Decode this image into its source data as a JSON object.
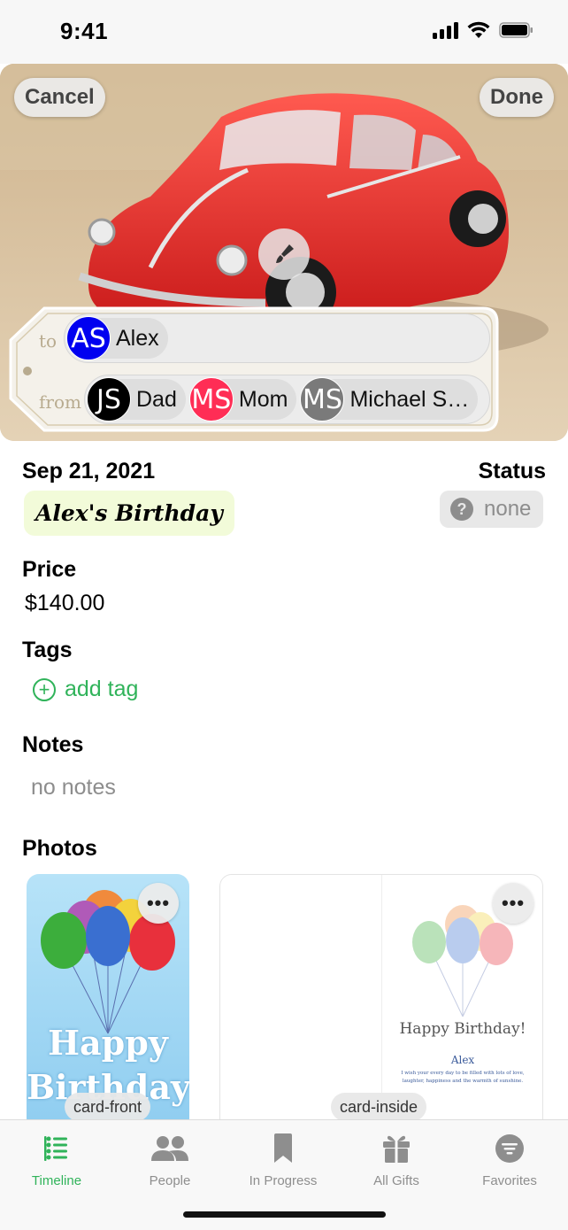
{
  "status_bar": {
    "time": "9:41"
  },
  "hero": {
    "cancel_label": "Cancel",
    "done_label": "Done",
    "tag": {
      "to_label": "to",
      "from_label": "from",
      "to": [
        {
          "initials": "AS",
          "name": "Alex",
          "color": "#0000f0"
        }
      ],
      "from": [
        {
          "initials": "JS",
          "name": "Dad",
          "color": "#000000"
        },
        {
          "initials": "MS",
          "name": "Mom",
          "color": "#ff2d55"
        },
        {
          "initials": "MS",
          "name": "Michael S…",
          "color": "#7a7a7a"
        }
      ]
    }
  },
  "details": {
    "date": "Sep 21, 2021",
    "occasion": "Alex's Birthday",
    "status_label": "Status",
    "status_value": "none",
    "price_label": "Price",
    "price_value": "$140.00",
    "tags_label": "Tags",
    "add_tag_label": "add tag",
    "notes_label": "Notes",
    "notes_value": "no notes",
    "photos_label": "Photos"
  },
  "photos": [
    {
      "caption": "card-front",
      "text_line1": "Happy",
      "text_line2": "Birthday!"
    },
    {
      "caption": "card-inside",
      "greeting": "Happy Birthday!",
      "name": "Alex",
      "message_line1": "I wish your every day to be filled with lots of love,",
      "message_line2": "laughter, happiness and the warmth of sunshine."
    }
  ],
  "tab_bar": {
    "tabs": [
      {
        "label": "Timeline",
        "icon": "timeline-icon",
        "active": true
      },
      {
        "label": "People",
        "icon": "people-icon",
        "active": false
      },
      {
        "label": "In Progress",
        "icon": "bookmark-icon",
        "active": false
      },
      {
        "label": "All Gifts",
        "icon": "gift-icon",
        "active": false
      },
      {
        "label": "Favorites",
        "icon": "favorites-icon",
        "active": false
      }
    ]
  },
  "colors": {
    "accent": "#30b35a",
    "occasion_bg": "#f2fbd9",
    "car_red": "#e82b2b"
  }
}
